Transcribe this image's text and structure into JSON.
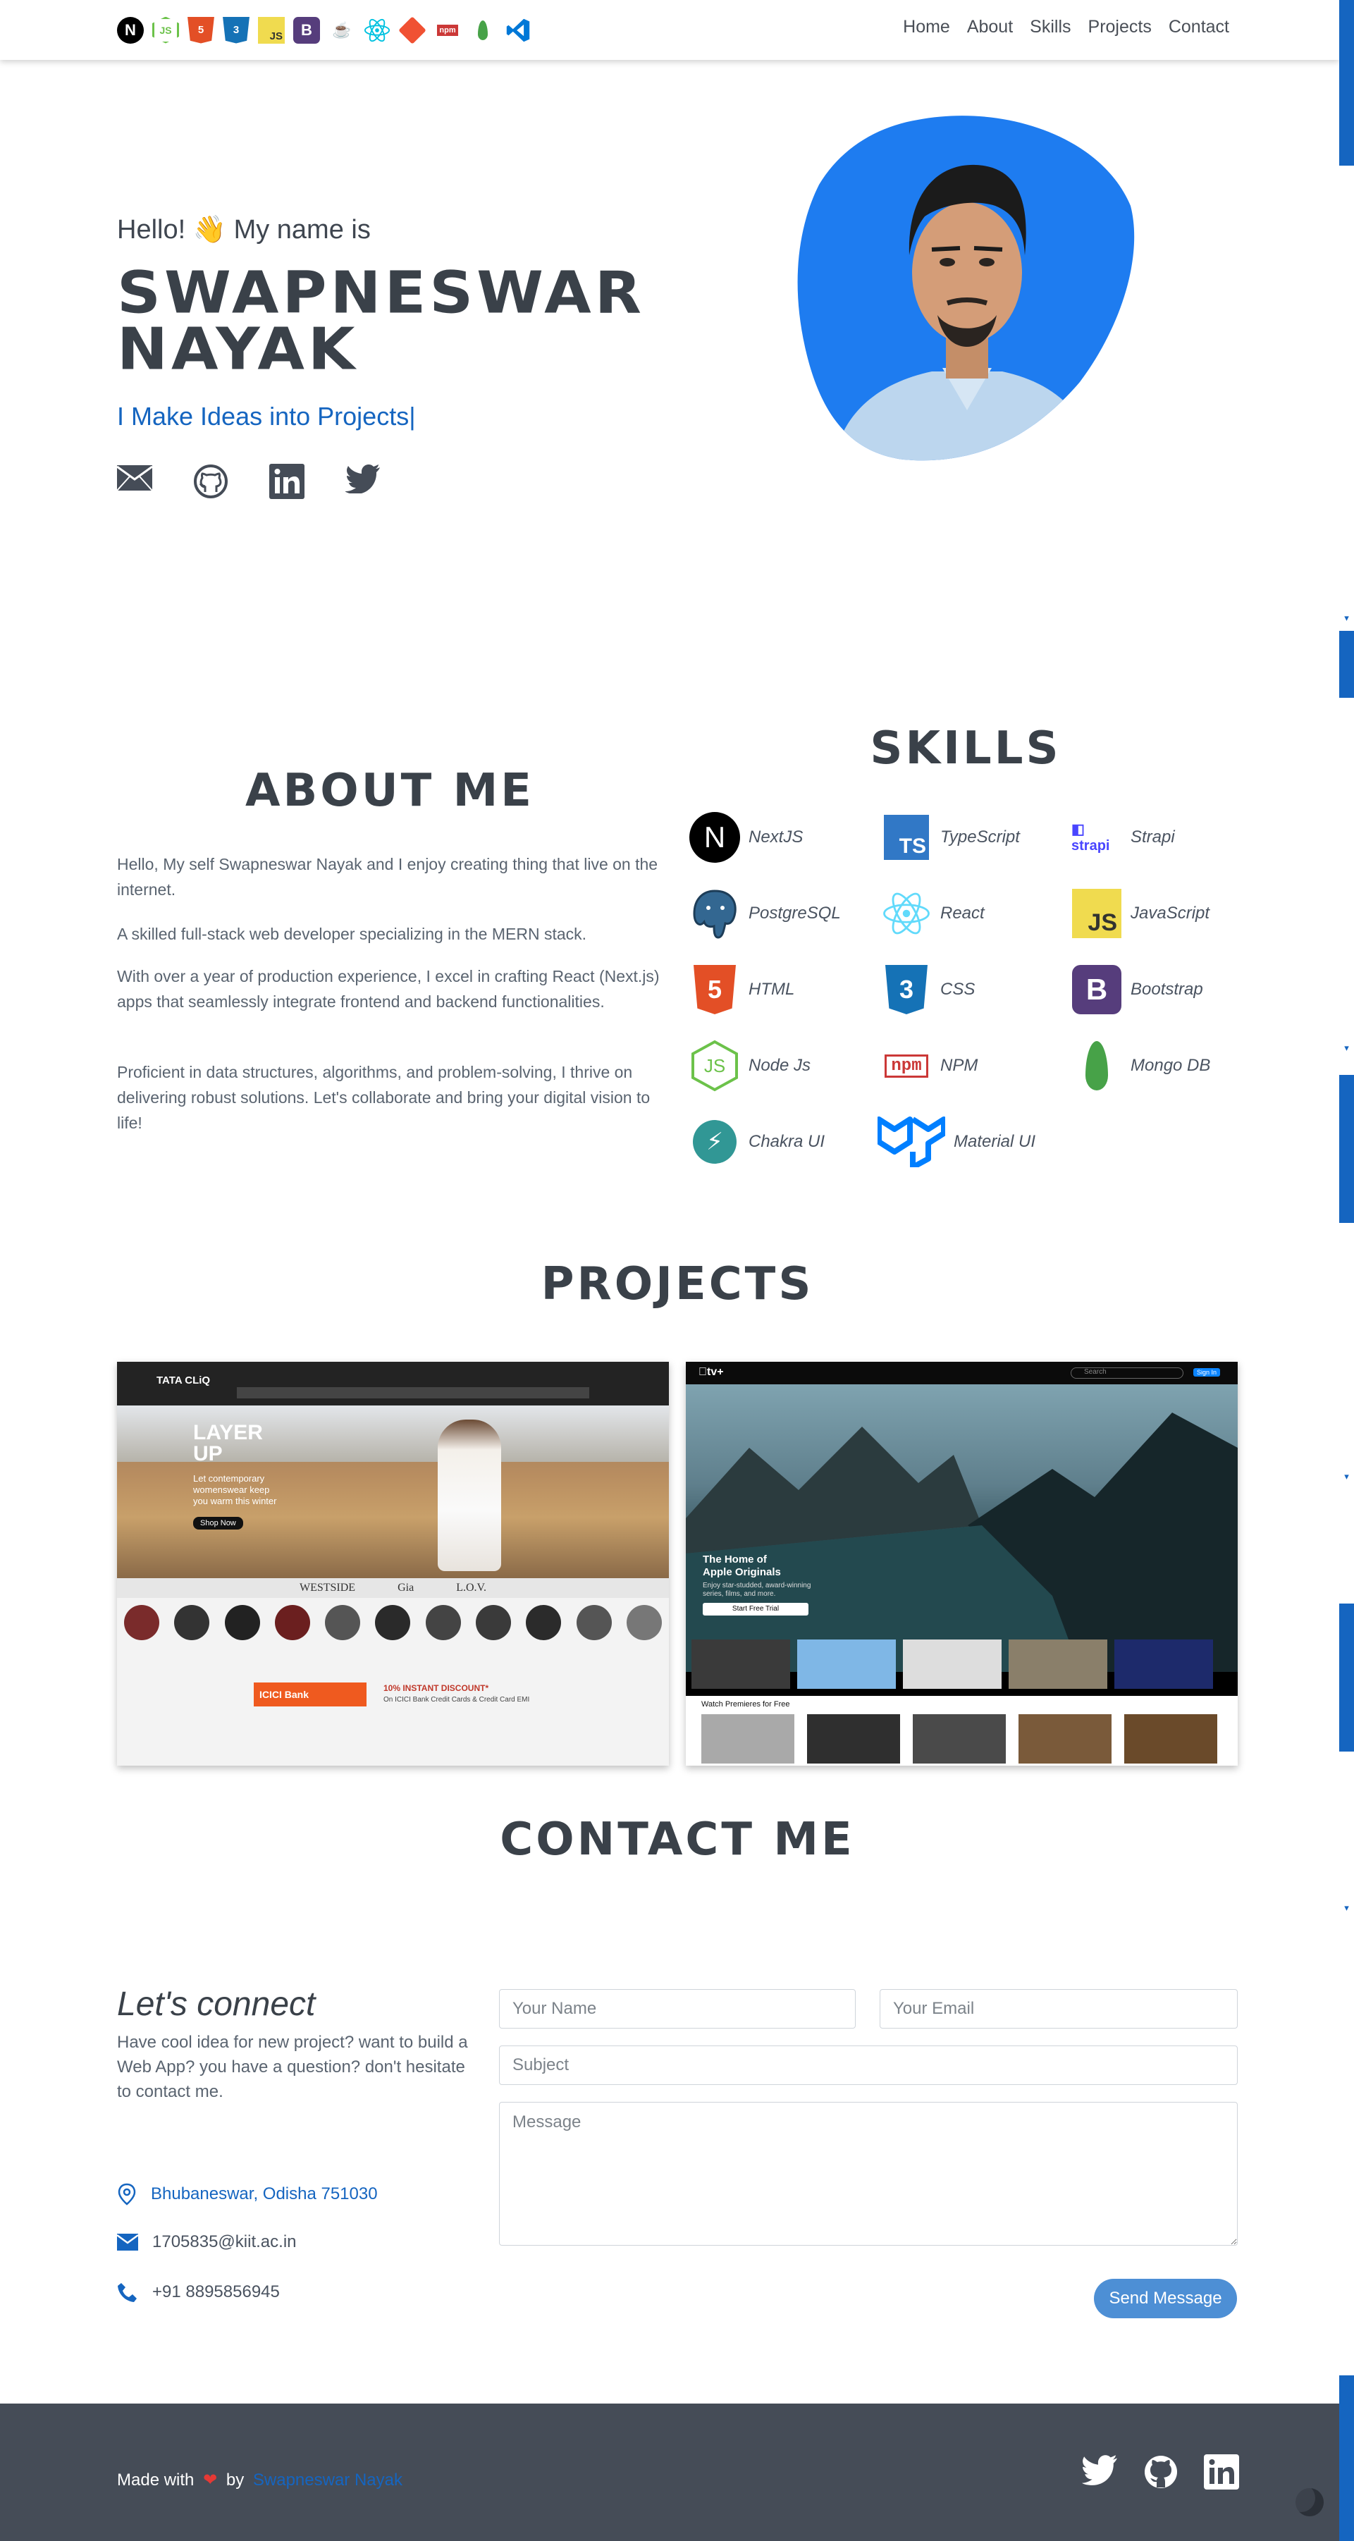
{
  "nav": {
    "tech_icons": [
      "nextjs-icon",
      "nodejs-icon",
      "html5-icon",
      "css3-icon",
      "javascript-icon",
      "bootstrap-icon",
      "java-icon",
      "react-icon",
      "git-icon",
      "npm-icon",
      "mongodb-icon",
      "vscode-icon"
    ],
    "links": [
      "Home",
      "About",
      "Skills",
      "Projects",
      "Contact"
    ]
  },
  "hero": {
    "greeting": "Hello! 👋 My name is",
    "name": "SWAPNESWAR NAYAK",
    "tagline": "I Make Ideas into Projects|",
    "social": [
      "email-icon",
      "github-icon",
      "linkedin-icon",
      "twitter-icon"
    ]
  },
  "about": {
    "title": "ABOUT ME",
    "paragraphs": [
      "Hello, My self Swapneswar Nayak and I enjoy creating thing that live on the internet.",
      "A skilled full-stack web developer specializing in the MERN stack.",
      "With over a year of production experience, I excel in crafting React (Next.js) apps that seamlessly integrate frontend and backend functionalities.",
      "Proficient in data structures, algorithms, and problem-solving, I thrive on delivering robust solutions. Let's collaborate and bring your digital vision to life!"
    ]
  },
  "skills": {
    "title": "SKILLS",
    "items": [
      {
        "label": "NextJS",
        "icon": "nextjs-icon"
      },
      {
        "label": "TypeScript",
        "icon": "typescript-icon"
      },
      {
        "label": "Strapi",
        "icon": "strapi-icon"
      },
      {
        "label": "PostgreSQL",
        "icon": "postgresql-icon"
      },
      {
        "label": "React",
        "icon": "react-icon"
      },
      {
        "label": "JavaScript",
        "icon": "javascript-icon"
      },
      {
        "label": "HTML",
        "icon": "html5-icon"
      },
      {
        "label": "CSS",
        "icon": "css3-icon"
      },
      {
        "label": "Bootstrap",
        "icon": "bootstrap-icon"
      },
      {
        "label": "Node Js",
        "icon": "nodejs-icon"
      },
      {
        "label": "NPM",
        "icon": "npm-icon"
      },
      {
        "label": "Mongo DB",
        "icon": "mongodb-icon"
      },
      {
        "label": "Chakra UI",
        "icon": "chakra-icon"
      },
      {
        "label": "Material UI",
        "icon": "materialui-icon"
      }
    ]
  },
  "projects": {
    "title": "PROJECTS",
    "tatacliq": {
      "logo": "TATA CLiQ",
      "banner_line1": "LAYER",
      "banner_line2": "UP",
      "banner_sub": "Let contemporary womenswear keep you warm this winter",
      "banner_btn": "Shop Now",
      "brands": [
        "WESTSIDE",
        "Gia",
        "L.O.V."
      ],
      "offer": "10% INSTANT DISCOUNT*",
      "offer_sub": "On ICICI Bank Credit Cards & Credit Card EMI",
      "bank": "ICICI Bank"
    },
    "appletv": {
      "logo": "tv+",
      "search": "Search",
      "signin": "Sign In",
      "headline1": "The Home of",
      "headline2": "Apple Originals",
      "sub": "Enjoy star-studded, award-winning series, films, and more.",
      "btn": "Start Free Trial",
      "row_label": "Watch Premieres for Free"
    }
  },
  "contact": {
    "title": "CONTACT ME",
    "heading": "Let's connect",
    "desc": "Have cool idea for new project? want to build a Web App? you have a question? don't hesitate to contact me.",
    "address": "Bhubaneswar, Odisha 751030",
    "email": "1705835@kiit.ac.in",
    "phone": "+91 8895856945",
    "name_ph": "Your Name",
    "email_ph": "Your Email",
    "subject_ph": "Subject",
    "message_ph": "Message",
    "send": "Send Message"
  },
  "footer": {
    "made_with": "Made with",
    "by": "by",
    "author": "Swapneswar Nayak",
    "icons": [
      "twitter-icon",
      "github-icon",
      "linkedin-icon"
    ]
  },
  "colors": {
    "accent": "#1565c0",
    "footer": "#454c57",
    "blob": "#1e7cf0"
  }
}
